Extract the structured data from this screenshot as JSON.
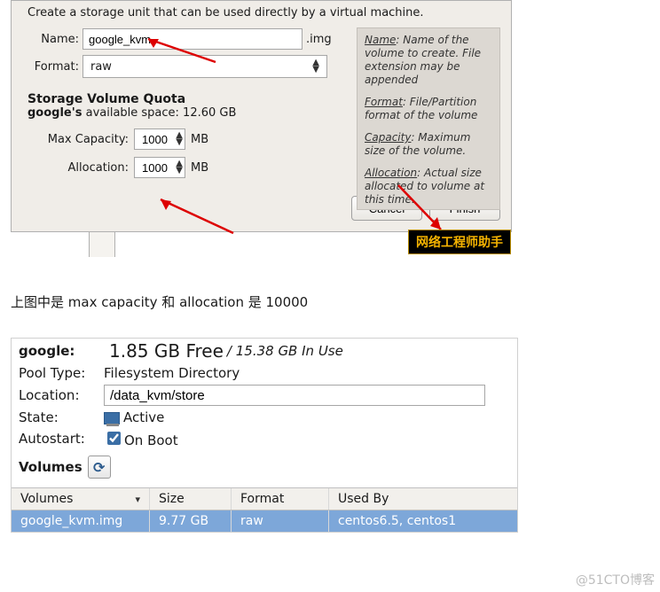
{
  "dialog": {
    "intro": "Create a storage unit that can be used directly by a virtual machine.",
    "name_label": "Name:",
    "name_value": "google_kvm",
    "name_ext": ".img",
    "format_label": "Format:",
    "format_value": "raw",
    "quota_title": "Storage Volume Quota",
    "quota_owner": "google's",
    "quota_text": " available space: 12.60 GB",
    "max_label": "Max Capacity:",
    "max_value": "1000",
    "alloc_label": "Allocation:",
    "alloc_value": "1000",
    "unit": "MB",
    "cancel": "Cancel",
    "finish": "Finish",
    "hints": {
      "name_t": "Name",
      "name_d": ": Name of the volume to create. File extension may be appended",
      "format_t": "Format",
      "format_d": ": File/Partition format of the volume",
      "cap_t": "Capacity",
      "cap_d": ": Maximum size of the volume.",
      "alloc_t": "Allocation",
      "alloc_d": ": Actual size allocated to volume at this time."
    },
    "badge": "网络工程师助手"
  },
  "caption": "上图中是 max capacity 和 allocation 是 10000",
  "pool": {
    "name_label": "google:",
    "free": "1.85 GB Free",
    "inuse": "/ 15.38 GB In Use",
    "type_label": "Pool Type:",
    "type_value": "Filesystem Directory",
    "loc_label": "Location:",
    "loc_value": "/data_kvm/store",
    "state_label": "State:",
    "state_value": "Active",
    "auto_label": "Autostart:",
    "auto_value": "On Boot",
    "volumes_label": "Volumes",
    "table": {
      "h1": "Volumes",
      "h2": "Size",
      "h3": "Format",
      "h4": "Used By",
      "r1c1": "google_kvm.img",
      "r1c2": "9.77 GB",
      "r1c3": "raw",
      "r1c4": "centos6.5, centos1"
    }
  },
  "watermark": "@51CTO博客"
}
